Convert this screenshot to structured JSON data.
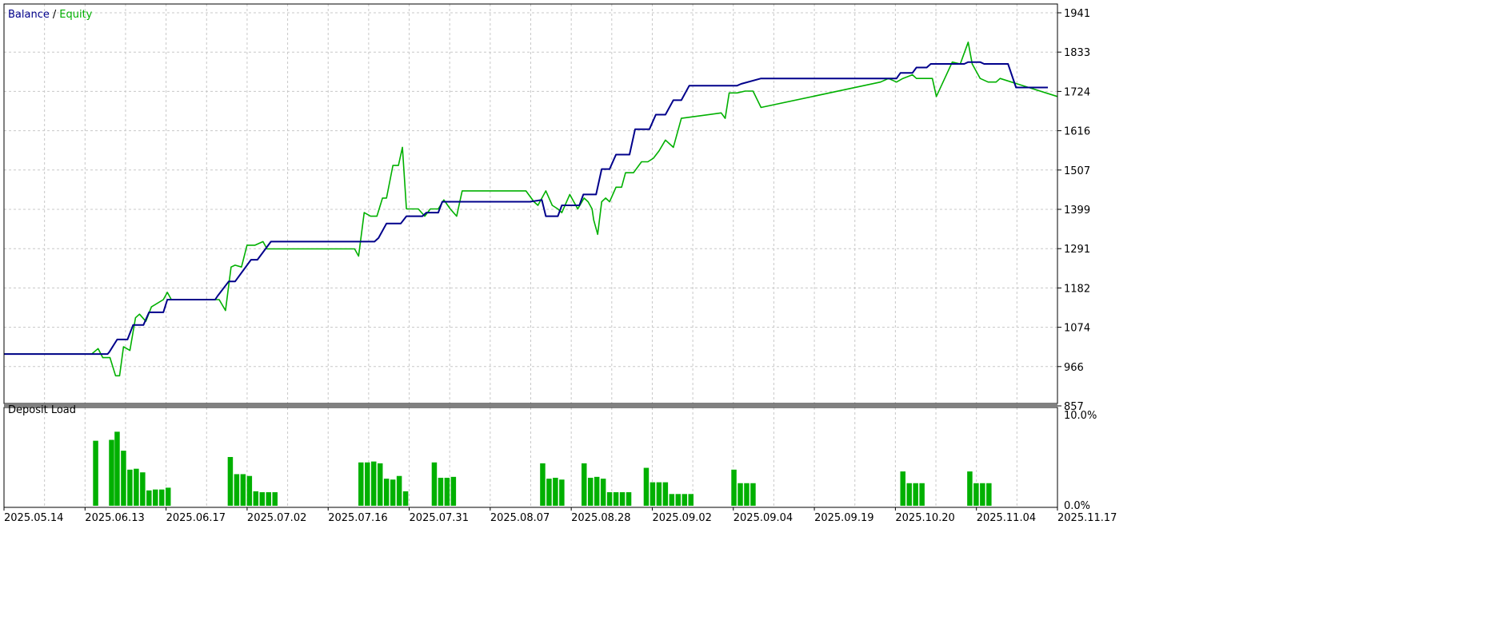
{
  "colors": {
    "balance": "#00008B",
    "equity": "#00B000",
    "deposit_load": "#00B000",
    "grid": "#C8C8C8",
    "frame": "#000000",
    "separator": "#808080"
  },
  "chart_data": [
    {
      "type": "line",
      "title": "Balance / Equity",
      "legend": [
        {
          "name": "Balance",
          "color": "#00008B"
        },
        {
          "name": "Equity",
          "color": "#00B000"
        }
      ],
      "legend_placement": "top-left",
      "grid": true,
      "xlim": [
        0,
        1322
      ],
      "ylim": [
        857,
        1941
      ],
      "y_ticks": [
        "1941",
        "1833",
        "1724",
        "1616",
        "1507",
        "1399",
        "1291",
        "1182",
        "1074",
        "966",
        "857"
      ],
      "series": [
        {
          "name": "Balance",
          "x": [
            0,
            130,
            132,
            142,
            155,
            162,
            175,
            182,
            200,
            205,
            212,
            265,
            268,
            282,
            290,
            310,
            318,
            335,
            465,
            470,
            480,
            498,
            505,
            525,
            530,
            545,
            550,
            562,
            570,
            660,
            675,
            680,
            695,
            700,
            722,
            727,
            743,
            750,
            760,
            768,
            785,
            792,
            810,
            818,
            830,
            840,
            850,
            860,
            880,
            920,
            925,
            950,
            1120,
            1125,
            1140,
            1145,
            1158,
            1163,
            1205,
            1210,
            1225,
            1230,
            1260,
            1270,
            1310
          ],
          "y": [
            1000,
            1000,
            1005,
            1040,
            1040,
            1080,
            1080,
            1115,
            1115,
            1150,
            1150,
            1150,
            1160,
            1200,
            1200,
            1260,
            1260,
            1310,
            1310,
            1320,
            1360,
            1360,
            1380,
            1380,
            1390,
            1390,
            1420,
            1420,
            1420,
            1420,
            1425,
            1380,
            1380,
            1410,
            1410,
            1440,
            1440,
            1510,
            1510,
            1550,
            1550,
            1620,
            1620,
            1660,
            1660,
            1700,
            1700,
            1740,
            1740,
            1740,
            1745,
            1760,
            1760,
            1775,
            1775,
            1790,
            1790,
            1800,
            1800,
            1805,
            1805,
            1800,
            1800,
            1735,
            1735
          ]
        },
        {
          "name": "Equity",
          "x": [
            0,
            110,
            118,
            124,
            133,
            140,
            145,
            150,
            158,
            165,
            170,
            178,
            185,
            200,
            205,
            210,
            220,
            265,
            270,
            278,
            285,
            290,
            298,
            305,
            315,
            325,
            330,
            340,
            440,
            445,
            452,
            460,
            468,
            475,
            480,
            488,
            495,
            500,
            505,
            520,
            528,
            535,
            545,
            552,
            560,
            568,
            575,
            655,
            665,
            670,
            680,
            688,
            695,
            700,
            710,
            720,
            728,
            733,
            738,
            740,
            745,
            750,
            755,
            760,
            768,
            775,
            780,
            790,
            800,
            808,
            815,
            822,
            830,
            840,
            850,
            900,
            905,
            910,
            920,
            930,
            940,
            950,
            1100,
            1110,
            1120,
            1128,
            1140,
            1145,
            1155,
            1165,
            1170,
            1190,
            1200,
            1210,
            1215,
            1225,
            1235,
            1245,
            1250,
            1322
          ],
          "y": [
            1000,
            1000,
            1015,
            990,
            990,
            940,
            940,
            1020,
            1010,
            1100,
            1110,
            1090,
            1130,
            1150,
            1170,
            1150,
            1150,
            1150,
            1150,
            1120,
            1240,
            1245,
            1240,
            1300,
            1300,
            1310,
            1290,
            1290,
            1290,
            1270,
            1390,
            1380,
            1380,
            1430,
            1430,
            1520,
            1520,
            1570,
            1400,
            1400,
            1380,
            1400,
            1400,
            1425,
            1400,
            1380,
            1450,
            1450,
            1420,
            1410,
            1450,
            1410,
            1400,
            1390,
            1440,
            1400,
            1430,
            1420,
            1400,
            1370,
            1330,
            1420,
            1430,
            1420,
            1460,
            1460,
            1500,
            1500,
            1530,
            1530,
            1540,
            1560,
            1590,
            1570,
            1650,
            1665,
            1650,
            1720,
            1720,
            1725,
            1725,
            1680,
            1750,
            1760,
            1750,
            1760,
            1770,
            1760,
            1760,
            1760,
            1710,
            1805,
            1800,
            1860,
            1800,
            1760,
            1750,
            1750,
            1760,
            1710
          ]
        }
      ]
    },
    {
      "type": "bar",
      "title": "Deposit Load",
      "grid": true,
      "xlim": [
        0,
        1322
      ],
      "ylim": [
        0,
        10
      ],
      "y_ticks": [
        "10.0%",
        "0.0%"
      ],
      "bars": {
        "x": [
          115,
          135,
          142,
          150,
          158,
          166,
          174,
          182,
          190,
          198,
          206,
          284,
          292,
          300,
          308,
          316,
          324,
          332,
          340,
          448,
          456,
          464,
          472,
          480,
          488,
          496,
          504,
          540,
          548,
          556,
          564,
          676,
          684,
          692,
          700,
          728,
          736,
          744,
          752,
          760,
          768,
          776,
          784,
          806,
          814,
          822,
          830,
          838,
          846,
          854,
          862,
          916,
          924,
          932,
          940,
          1128,
          1136,
          1144,
          1152,
          1212,
          1220,
          1228,
          1236
        ],
        "values": [
          7.2,
          7.3,
          8.2,
          6.1,
          4.0,
          4.1,
          3.7,
          1.7,
          1.8,
          1.8,
          2.0,
          5.4,
          3.5,
          3.5,
          3.3,
          1.6,
          1.5,
          1.5,
          1.5,
          4.8,
          4.8,
          4.9,
          4.7,
          3.0,
          2.9,
          3.3,
          1.6,
          4.8,
          3.1,
          3.1,
          3.2,
          4.7,
          3.0,
          3.1,
          2.9,
          4.7,
          3.1,
          3.2,
          3.0,
          1.5,
          1.5,
          1.5,
          1.5,
          4.2,
          2.6,
          2.6,
          2.6,
          1.3,
          1.3,
          1.3,
          1.3,
          4.0,
          2.5,
          2.5,
          2.5,
          3.8,
          2.5,
          2.5,
          2.5,
          3.8,
          2.5,
          2.5,
          2.5
        ]
      }
    }
  ],
  "x_axis": {
    "labels": [
      "2025.05.14",
      "2025.06.13",
      "2025.06.17",
      "2025.07.02",
      "2025.07.16",
      "2025.07.31",
      "2025.08.07",
      "2025.08.28",
      "2025.09.02",
      "2025.09.04",
      "2025.09.19",
      "2025.10.20",
      "2025.11.04",
      "2025.11.17"
    ]
  }
}
